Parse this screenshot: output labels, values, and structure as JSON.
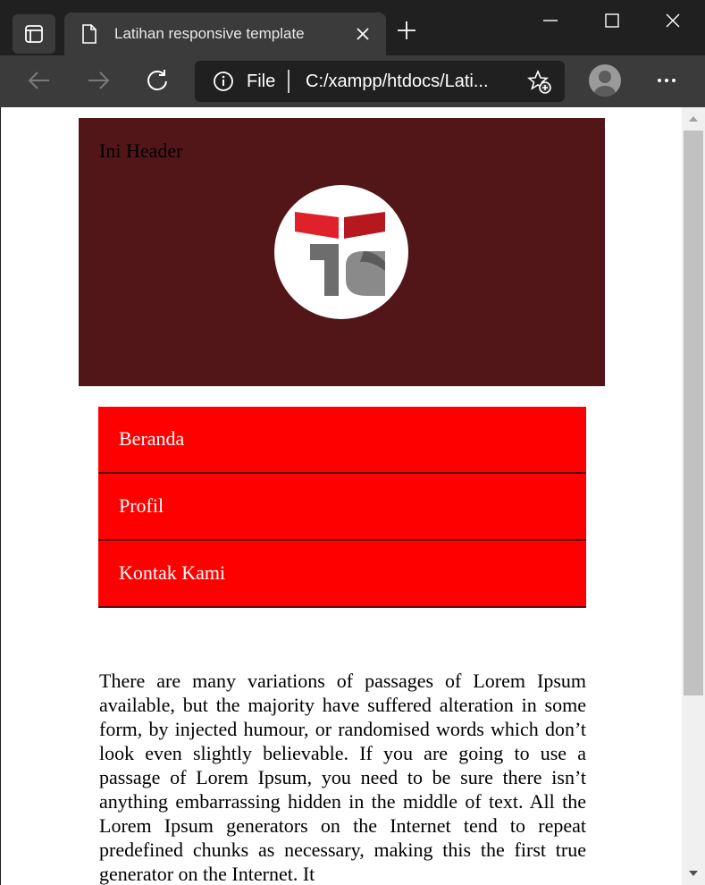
{
  "browser": {
    "tab_title": "Latihan responsive template",
    "address_scheme": "File",
    "address_url": "C:/xampp/htdocs/Lati..."
  },
  "page": {
    "header_text": "Ini Header",
    "nav": [
      {
        "label": "Beranda"
      },
      {
        "label": "Profil"
      },
      {
        "label": "Kontak Kami"
      }
    ],
    "paragraph": "There are many variations of passages of Lorem Ipsum available, but the majority have suffered alteration in some form, by injected humour, or randomised words which don’t look even slightly believable. If you are going to use a passage of Lorem Ipsum, you need to be sure there isn’t anything embarrassing hidden in the middle of text. All the Lorem Ipsum generators on the Internet tend to repeat predefined chunks as necessary, making this the first true generator on the Internet. It"
  },
  "colors": {
    "header_bg": "#521619",
    "nav_bg": "#ff0000",
    "logo_red": "#e0202a",
    "logo_gray": "#6d6d6d"
  }
}
